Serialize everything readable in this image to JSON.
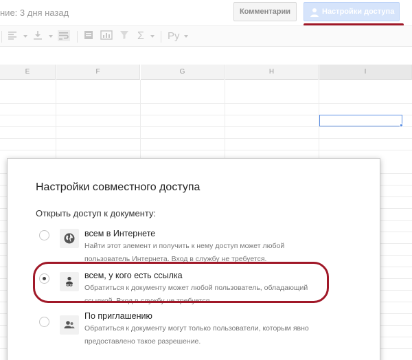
{
  "header": {
    "last_edit": "ние: 3 дня назад",
    "comments_label": "Комментарии",
    "share_label": "Настройки доступа",
    "accent_color": "#a01828"
  },
  "toolbar": {
    "items": [
      "align-left-icon",
      "valign-bottom-icon",
      "wrap-text-icon",
      "merge-icon",
      "chart-icon",
      "filter-icon",
      "sigma-icon",
      "input-tools-icon"
    ],
    "input_tools_label": "Ру",
    "sigma_label": "Σ"
  },
  "sheet": {
    "columns": [
      "E",
      "F",
      "G",
      "H",
      "I"
    ],
    "selected_column": "I"
  },
  "dialog": {
    "title": "Настройки совместного доступа",
    "subtitle": "Открыть доступ к документу:",
    "options": [
      {
        "label": "всем в Интернете",
        "desc1": "Найти этот элемент и получить к нему доступ может любой",
        "desc2": "пользователь Интернета. Вход в службу не требуется.",
        "selected": false,
        "icon": "globe-icon"
      },
      {
        "label": "всем, у кого есть ссылка",
        "desc1": "Обратиться к документу может любой пользователь, обладающий",
        "desc2": "ссылкой. Вход в службу не требуется.",
        "selected": true,
        "icon": "link-person-icon"
      },
      {
        "label": "По приглашению",
        "desc1": "Обратиться к документу могут только пользователи, которым явно",
        "desc2": "предоставлено такое разрешение.",
        "selected": false,
        "icon": "people-icon"
      }
    ]
  }
}
